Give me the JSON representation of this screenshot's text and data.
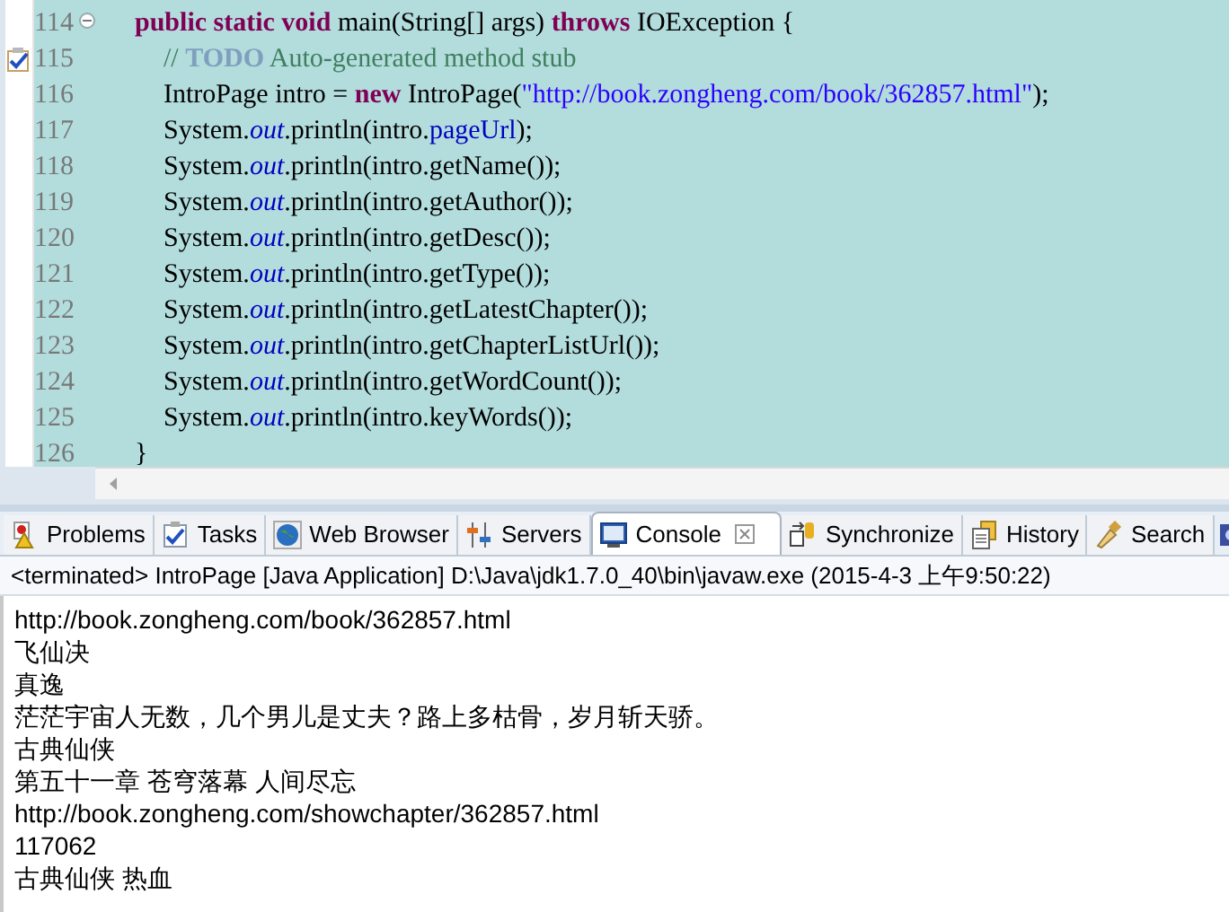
{
  "editor": {
    "lines": [
      {
        "number": "114",
        "collapsible": true,
        "task": false,
        "tokens": [
          {
            "t": "public static void",
            "kind": "keyword"
          },
          {
            "t": " main(String[] args) ",
            "kind": "plain"
          },
          {
            "t": "throws",
            "kind": "keyword"
          },
          {
            "t": " IOException {",
            "kind": "plain"
          }
        ],
        "children": [
          {
            "number": "115",
            "collapsible": false,
            "task": true,
            "tokens": [
              {
                "t": "// ",
                "kind": "comment"
              },
              {
                "t": "TODO",
                "kind": "todo"
              },
              {
                "t": " Auto-generated method stub",
                "kind": "comment"
              }
            ]
          },
          {
            "number": "116",
            "collapsible": false,
            "task": false,
            "tokens": [
              {
                "t": "IntroPage intro = ",
                "kind": "plain"
              },
              {
                "t": "new",
                "kind": "keyword"
              },
              {
                "t": " IntroPage(",
                "kind": "plain"
              },
              {
                "t": "\"http://book.zongheng.com/book/362857.html\"",
                "kind": "string"
              },
              {
                "t": ");",
                "kind": "plain"
              }
            ]
          },
          {
            "number": "117",
            "collapsible": false,
            "task": false,
            "tokens": [
              {
                "t": "System.",
                "kind": "plain"
              },
              {
                "t": "out",
                "kind": "static"
              },
              {
                "t": ".println(intro.",
                "kind": "plain"
              },
              {
                "t": "pageUrl",
                "kind": "field"
              },
              {
                "t": ");",
                "kind": "plain"
              }
            ]
          },
          {
            "number": "118",
            "collapsible": false,
            "task": false,
            "tokens": [
              {
                "t": "System.",
                "kind": "plain"
              },
              {
                "t": "out",
                "kind": "static"
              },
              {
                "t": ".println(intro.getName());",
                "kind": "plain"
              }
            ]
          },
          {
            "number": "119",
            "collapsible": false,
            "task": false,
            "tokens": [
              {
                "t": "System.",
                "kind": "plain"
              },
              {
                "t": "out",
                "kind": "static"
              },
              {
                "t": ".println(intro.getAuthor());",
                "kind": "plain"
              }
            ]
          },
          {
            "number": "120",
            "collapsible": false,
            "task": false,
            "tokens": [
              {
                "t": "System.",
                "kind": "plain"
              },
              {
                "t": "out",
                "kind": "static"
              },
              {
                "t": ".println(intro.getDesc());",
                "kind": "plain"
              }
            ]
          },
          {
            "number": "121",
            "collapsible": false,
            "task": false,
            "tokens": [
              {
                "t": "System.",
                "kind": "plain"
              },
              {
                "t": "out",
                "kind": "static"
              },
              {
                "t": ".println(intro.getType());",
                "kind": "plain"
              }
            ]
          },
          {
            "number": "122",
            "collapsible": false,
            "task": false,
            "tokens": [
              {
                "t": "System.",
                "kind": "plain"
              },
              {
                "t": "out",
                "kind": "static"
              },
              {
                "t": ".println(intro.getLatestChapter());",
                "kind": "plain"
              }
            ]
          },
          {
            "number": "123",
            "collapsible": false,
            "task": false,
            "tokens": [
              {
                "t": "System.",
                "kind": "plain"
              },
              {
                "t": "out",
                "kind": "static"
              },
              {
                "t": ".println(intro.getChapterListUrl());",
                "kind": "plain"
              }
            ]
          },
          {
            "number": "124",
            "collapsible": false,
            "task": false,
            "tokens": [
              {
                "t": "System.",
                "kind": "plain"
              },
              {
                "t": "out",
                "kind": "static"
              },
              {
                "t": ".println(intro.getWordCount());",
                "kind": "plain"
              }
            ]
          },
          {
            "number": "125",
            "collapsible": false,
            "task": false,
            "tokens": [
              {
                "t": "System.",
                "kind": "plain"
              },
              {
                "t": "out",
                "kind": "static"
              },
              {
                "t": ".println(intro.keyWords());",
                "kind": "plain"
              }
            ]
          }
        ]
      },
      {
        "number": "126",
        "collapsible": false,
        "task": false,
        "tokens": [
          {
            "t": "}",
            "kind": "plain"
          }
        ]
      }
    ]
  },
  "tabs": [
    {
      "label": "Problems",
      "kind": "problems",
      "selected": false
    },
    {
      "label": "Tasks",
      "kind": "tasks",
      "selected": false
    },
    {
      "label": "Web Browser",
      "kind": "browser",
      "selected": false
    },
    {
      "label": "Servers",
      "kind": "servers",
      "selected": false
    },
    {
      "label": "Console",
      "kind": "console",
      "selected": true
    },
    {
      "label": "Synchronize",
      "kind": "sync",
      "selected": false
    },
    {
      "label": "History",
      "kind": "history",
      "selected": false
    },
    {
      "label": "Search",
      "kind": "search",
      "selected": false
    }
  ],
  "console": {
    "status": "<terminated> IntroPage [Java Application] D:\\Java\\jdk1.7.0_40\\bin\\javaw.exe (2015-4-3 上午9:50:22)",
    "output": [
      "http://book.zongheng.com/book/362857.html",
      "飞仙决",
      "真逸",
      "茫茫宇宙人无数，几个男儿是丈夫？路上多枯骨，岁月斩天骄。",
      "古典仙侠",
      "第五十一章 苍穹落幕 人间尽忘",
      "http://book.zongheng.com/showchapter/362857.html",
      "117062",
      "古典仙侠 热血"
    ]
  }
}
